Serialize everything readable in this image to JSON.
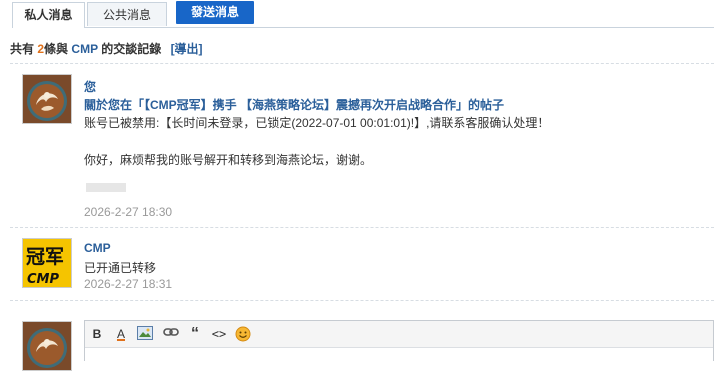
{
  "tabs": [
    {
      "label": "私人消息",
      "active": true
    },
    {
      "label": "公共消息",
      "active": false
    }
  ],
  "send_button": "發送消息",
  "summary": {
    "prefix": "共有",
    "count": "2",
    "middle": "條與",
    "partner": "CMP",
    "suffix": "的交談記錄",
    "export": "[導出]"
  },
  "messages": [
    {
      "sender": "您",
      "subject": "關於您在「【CMP冠军】携手 【海燕策略论坛】震撼再次开启战略合作」的帖子",
      "lines": [
        "账号已被禁用:【长时间未登录，已锁定(2022-07-01 00:01:01)!】,请联系客服确认处理！",
        "你好，麻烦帮我的账号解开和转移到海燕论坛，谢谢。"
      ],
      "time": "2026-2-27 18:30",
      "avatar": "latte-art-avatar"
    },
    {
      "sender": "CMP",
      "lines": [
        "已开通已转移"
      ],
      "time": "2026-2-27 18:31",
      "avatar": "cmp-logo-avatar",
      "avatar_text_top": "冠军",
      "avatar_text_bottom": "CMP"
    }
  ],
  "editor": {
    "tools": [
      "bold-icon",
      "font-color-icon",
      "image-icon",
      "link-icon",
      "quote-icon",
      "code-icon",
      "smiley-icon"
    ],
    "bold_glyph": "B",
    "font_color_glyph": "A",
    "quote_glyph": "“",
    "code_glyph": "<>",
    "accent": "#1866c8"
  },
  "colors": {
    "link_blue": "#2b5f9a",
    "count_orange": "#e0711b",
    "button_blue": "#1866c8"
  }
}
